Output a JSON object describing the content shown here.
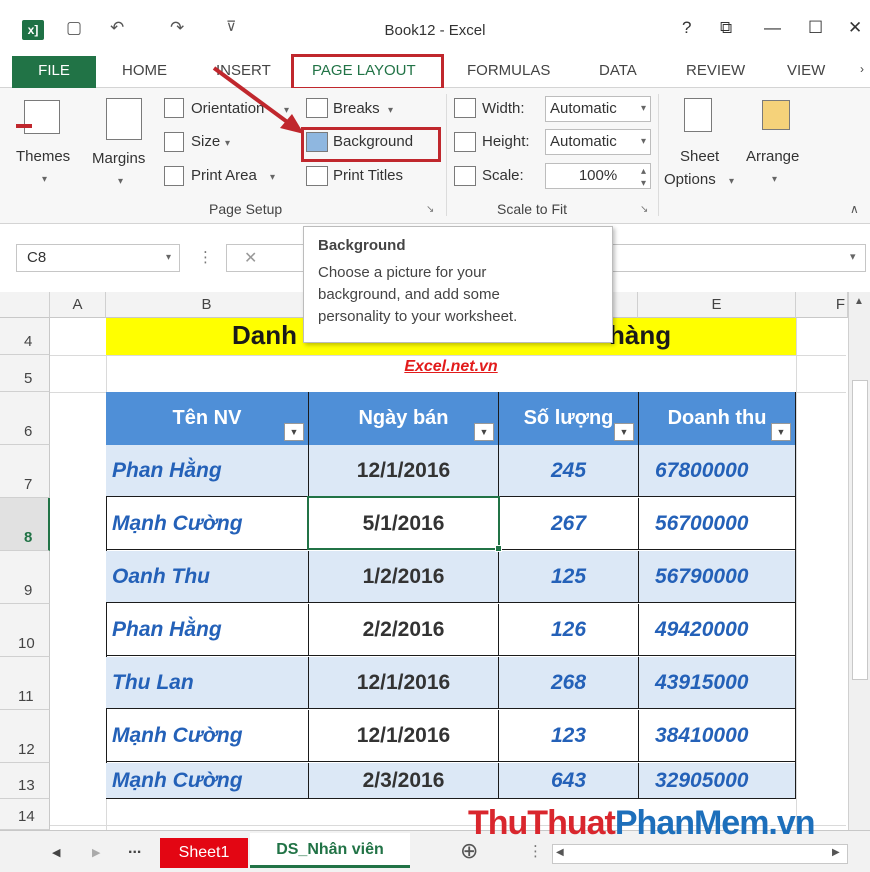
{
  "window": {
    "title": "Book12 - Excel",
    "help": "?",
    "restore": "⧉",
    "minimize": "—",
    "maximize": "☐",
    "close": "✕",
    "excel_logo": "x]"
  },
  "quick_access": {
    "save": "💾",
    "undo": "↶",
    "redo": "↷",
    "customize": "⊽"
  },
  "tabs": {
    "file": "FILE",
    "home": "HOME",
    "insert": "INSERT",
    "page_layout": "PAGE LAYOUT",
    "formulas": "FORMULAS",
    "data": "DATA",
    "review": "REVIEW",
    "view": "VIEW"
  },
  "ribbon": {
    "themes": "Themes",
    "margins": "Margins",
    "orientation": "Orientation",
    "size": "Size",
    "print_area": "Print Area",
    "breaks": "Breaks",
    "background": "Background",
    "print_titles": "Print Titles",
    "page_setup": "Page Setup",
    "width_label": "Width:",
    "width_value": "Automatic",
    "height_label": "Height:",
    "height_value": "Automatic",
    "scale_label": "Scale:",
    "scale_value": "100%",
    "scale_to_fit": "Scale to Fit",
    "sheet_options": "Sheet",
    "sheet_options2": "Options",
    "arrange": "Arrange"
  },
  "formula_bar": {
    "name_box": "C8",
    "cancel": "✕",
    "dots": "⋮"
  },
  "tooltip": {
    "title": "Background",
    "line1": "Choose a picture for your",
    "line2": "background, and add some",
    "line3": "personality to your worksheet."
  },
  "columns": [
    "A",
    "B",
    "E",
    "F"
  ],
  "rows": [
    "4",
    "5",
    "6",
    "7",
    "8",
    "9",
    "10",
    "11",
    "12",
    "13",
    "14"
  ],
  "sheet": {
    "banner_left": "Danh",
    "banner_right": "hàng",
    "site": "Excel.net.vn",
    "headers": [
      "Tên NV",
      "Ngày bán",
      "Số lượng",
      "Doanh thu"
    ],
    "data": [
      [
        "Phan Hằng",
        "12/1/2016",
        "245",
        "67800000"
      ],
      [
        "Mạnh Cường",
        "5/1/2016",
        "267",
        "56700000"
      ],
      [
        "Oanh Thu",
        "1/2/2016",
        "125",
        "56790000"
      ],
      [
        "Phan Hằng",
        "2/2/2016",
        "126",
        "49420000"
      ],
      [
        "Thu Lan",
        "12/1/2016",
        "268",
        "43915000"
      ],
      [
        "Mạnh Cường",
        "12/1/2016",
        "123",
        "38410000"
      ],
      [
        "Mạnh Cường",
        "2/3/2016",
        "643",
        "32905000"
      ]
    ]
  },
  "sheet_tabs": {
    "more": "...",
    "sheet1": "Sheet1",
    "sheet2": "DS_Nhân viên",
    "add": "⊕"
  },
  "watermark": {
    "part1": "ThuThuat",
    "part2": "PhanMem.vn"
  },
  "colors": {
    "excel_green": "#217346",
    "header_blue": "#4f8fd7",
    "highlight_red": "#c0272d",
    "banner_yellow": "#ffff00"
  }
}
